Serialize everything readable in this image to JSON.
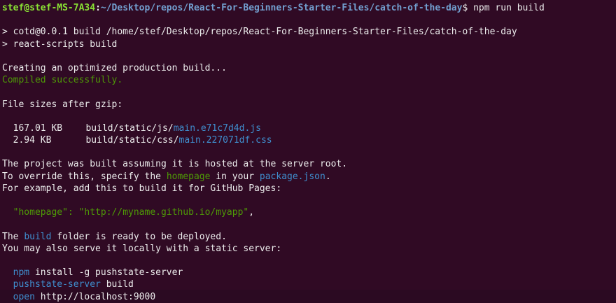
{
  "prompt": {
    "user_host": "stef@stef-MS-7A34",
    "separator": ":",
    "path": "~/Desktop/repos/React-For-Beginners-Starter-Files/catch-of-the-day",
    "symbol": "$",
    "command": "npm run build"
  },
  "output": {
    "script_line_1": "> cotd@0.0.1 build /home/stef/Desktop/repos/React-For-Beginners-Starter-Files/catch-of-the-day",
    "script_line_2": "> react-scripts build",
    "creating": "Creating an optimized production build...",
    "compiled": "Compiled successfully.",
    "file_sizes_header": "File sizes after gzip:",
    "files": [
      {
        "size": "167.01 KB",
        "dir": "build/static/js/",
        "name": "main.e71c7d4d.js"
      },
      {
        "size": "2.94 KB",
        "dir": "build/static/css/",
        "name": "main.227071df.css"
      }
    ],
    "assume_line": "The project was built assuming it is hosted at the server root.",
    "override_pre": "To override this, specify the ",
    "override_homepage": "homepage",
    "override_mid": " in your ",
    "override_pkg": "package.json",
    "override_post": ".",
    "example_line": "For example, add this to build it for GitHub Pages:",
    "homepage_key": "\"homepage\"",
    "homepage_colon": ": ",
    "homepage_value": "\"http://myname.github.io/myapp\"",
    "homepage_comma": ",",
    "ready_pre": "The ",
    "ready_build": "build",
    "ready_post": " folder is ready to be deployed.",
    "serve_line": "You may also serve it locally with a static server:",
    "cmd1_npm": "npm",
    "cmd1_rest": " install -g pushstate-server",
    "cmd2_bin": "pushstate-server",
    "cmd2_rest": " build",
    "cmd3_open": "open",
    "cmd3_rest": " http://localhost:9000"
  },
  "colors": {
    "background": "#300a24",
    "text": "#ececec",
    "prompt_user": "#8ae234",
    "prompt_path": "#729fcf",
    "success_green": "#4e9a06",
    "link_cyan": "#3f8fcf"
  }
}
